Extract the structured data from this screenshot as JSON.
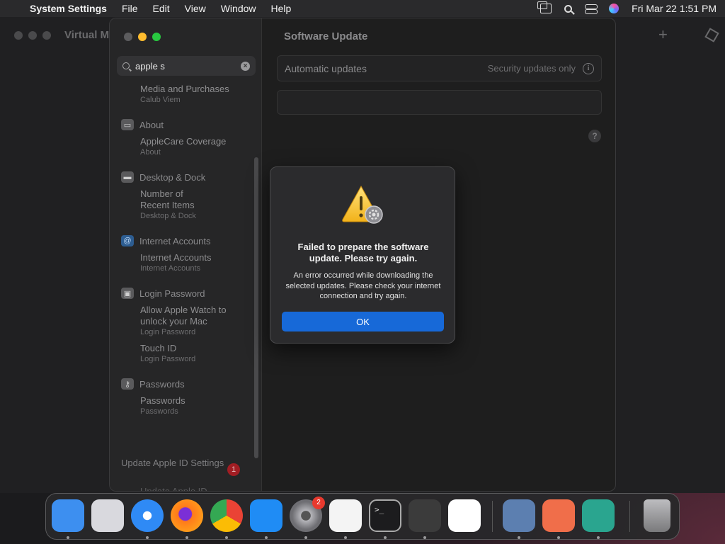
{
  "menubar": {
    "app_name": "System Settings",
    "menus": [
      "File",
      "Edit",
      "View",
      "Window",
      "Help"
    ],
    "clock": "Fri Mar 22  1:51 PM"
  },
  "background_window": {
    "title": "Virtual M"
  },
  "settings": {
    "search": {
      "value": "apple s"
    },
    "sidebar_results": [
      {
        "type": "item",
        "title": "Media and Purchases",
        "subtitle": "Calub Viem"
      },
      {
        "type": "header",
        "title": "About",
        "icon": "laptop-icon"
      },
      {
        "type": "item",
        "title": "AppleCare Coverage",
        "subtitle": "About"
      },
      {
        "type": "header",
        "title": "Desktop & Dock",
        "icon": "dock-icon"
      },
      {
        "type": "item",
        "title": "Number of\nRecent Items",
        "subtitle": "Desktop & Dock"
      },
      {
        "type": "header",
        "title": "Internet Accounts",
        "icon": "at-icon"
      },
      {
        "type": "item",
        "title": "Internet Accounts",
        "subtitle": "Internet Accounts"
      },
      {
        "type": "header",
        "title": "Login Password",
        "icon": "lock-icon"
      },
      {
        "type": "item",
        "title": "Allow Apple Watch to\nunlock your Mac",
        "subtitle": "Login Password"
      },
      {
        "type": "item",
        "title": "Touch ID",
        "subtitle": "Login Password"
      },
      {
        "type": "header",
        "title": "Passwords",
        "icon": "key-icon"
      },
      {
        "type": "item",
        "title": "Passwords",
        "subtitle": "Passwords"
      }
    ],
    "update_apple_id": {
      "label": "Update Apple ID Settings",
      "badge": "1",
      "faded_label": "Update Apple ID"
    },
    "main": {
      "title": "Software Update",
      "automatic_updates_label": "Automatic updates",
      "automatic_updates_value": "Security updates only",
      "help_glyph": "?"
    }
  },
  "alert": {
    "title": "Failed to prepare the software update. Please try again.",
    "message": "An error occurred while downloading the selected updates. Please check your internet connection and try again.",
    "ok_label": "OK"
  },
  "dock": {
    "apps": [
      {
        "name": "finder",
        "color": "#3d8ff0"
      },
      {
        "name": "launchpad",
        "color": "#d9d9de"
      },
      {
        "name": "safari",
        "color": "#2f8af5"
      },
      {
        "name": "firefox",
        "color": "#ff7a1a"
      },
      {
        "name": "chrome",
        "color": "#ffffff"
      },
      {
        "name": "app-store",
        "color": "#1f8cf5"
      },
      {
        "name": "system-settings",
        "color": "#8e8e93",
        "badge": "2"
      },
      {
        "name": "textedit",
        "color": "#f4f4f4"
      },
      {
        "name": "terminal",
        "color": "#1c1c1e"
      },
      {
        "name": "garageband",
        "color": "#3b3b3b"
      },
      {
        "name": "vscode",
        "color": "#ffffff"
      },
      {
        "name": "virtualbox",
        "color": "#5c7fb0"
      },
      {
        "name": "screen-sharing",
        "color": "#f06e4a"
      },
      {
        "name": "archive-utility",
        "color": "#2aa58f"
      },
      {
        "name": "trash",
        "color": "#9a9a9c"
      }
    ]
  }
}
